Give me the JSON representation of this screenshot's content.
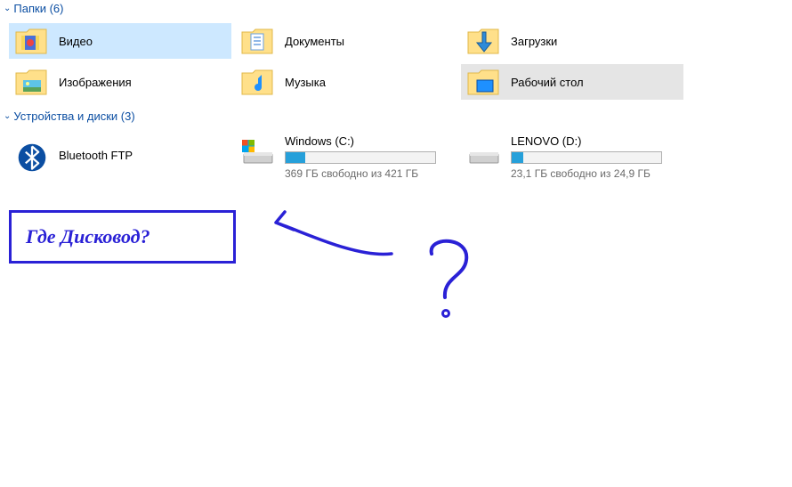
{
  "sections": {
    "folders": {
      "title": "Папки (6)"
    },
    "drives": {
      "title": "Устройства и диски (3)"
    }
  },
  "folders": [
    {
      "label": "Видео",
      "icon": "video",
      "state": "selected"
    },
    {
      "label": "Документы",
      "icon": "documents",
      "state": ""
    },
    {
      "label": "Загрузки",
      "icon": "downloads",
      "state": ""
    },
    {
      "label": "Изображения",
      "icon": "pictures",
      "state": ""
    },
    {
      "label": "Музыка",
      "icon": "music",
      "state": ""
    },
    {
      "label": "Рабочий стол",
      "icon": "desktop",
      "state": "hover"
    }
  ],
  "drives": [
    {
      "kind": "bluetooth",
      "name": "Bluetooth FTP",
      "free_text": "",
      "fill_pct": 0
    },
    {
      "kind": "disk",
      "name": "Windows (C:)",
      "free_text": "369 ГБ свободно из 421 ГБ",
      "fill_pct": 13,
      "os": true
    },
    {
      "kind": "disk",
      "name": "LENOVO (D:)",
      "free_text": "23,1 ГБ свободно из 24,9 ГБ",
      "fill_pct": 8,
      "os": false
    }
  ],
  "annotation": {
    "text": "Где Дисковод?"
  },
  "colors": {
    "accent": "#0b4ea2",
    "annotation": "#2a21d6",
    "drive_fill": "#26a0da",
    "selected_bg": "#cde8ff",
    "hover_bg": "#e5e5e5"
  }
}
